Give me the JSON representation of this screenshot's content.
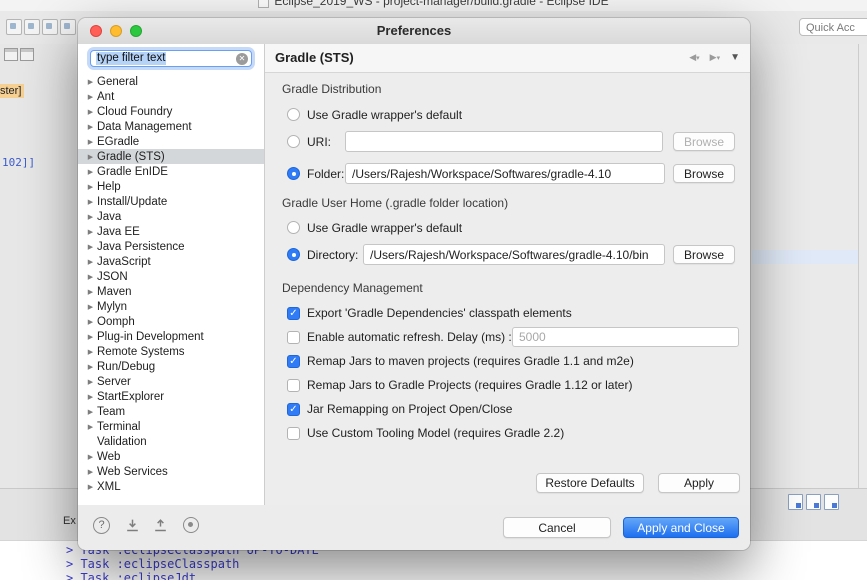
{
  "menubar": {
    "window_title": "Eclipse_2019_WS - project-manager/build.gradle - Eclipse IDE"
  },
  "toolbar": {
    "quick_access_label": "Quick Acc"
  },
  "workbench": {
    "left_fragment_tab": "ster]",
    "left_fragment_number": "102]]",
    "left_fragment_ex": "Ex",
    "console_lines": [
      "> Task :eclipseClasspath UP-TO-DATE",
      "> Task :eclipseClasspath",
      "> Task :eclipseJdt"
    ]
  },
  "dialog": {
    "title": "Preferences",
    "filter_text": "type filter text",
    "tree_items": [
      {
        "label": "General",
        "expandable": true,
        "selected": false
      },
      {
        "label": "Ant",
        "expandable": true,
        "selected": false
      },
      {
        "label": "Cloud Foundry",
        "expandable": true,
        "selected": false
      },
      {
        "label": "Data Management",
        "expandable": true,
        "selected": false
      },
      {
        "label": "EGradle",
        "expandable": true,
        "selected": false
      },
      {
        "label": "Gradle (STS)",
        "expandable": true,
        "selected": true
      },
      {
        "label": "Gradle EnIDE",
        "expandable": true,
        "selected": false
      },
      {
        "label": "Help",
        "expandable": true,
        "selected": false
      },
      {
        "label": "Install/Update",
        "expandable": true,
        "selected": false
      },
      {
        "label": "Java",
        "expandable": true,
        "selected": false
      },
      {
        "label": "Java EE",
        "expandable": true,
        "selected": false
      },
      {
        "label": "Java Persistence",
        "expandable": true,
        "selected": false
      },
      {
        "label": "JavaScript",
        "expandable": true,
        "selected": false
      },
      {
        "label": "JSON",
        "expandable": true,
        "selected": false
      },
      {
        "label": "Maven",
        "expandable": true,
        "selected": false
      },
      {
        "label": "Mylyn",
        "expandable": true,
        "selected": false
      },
      {
        "label": "Oomph",
        "expandable": true,
        "selected": false
      },
      {
        "label": "Plug-in Development",
        "expandable": true,
        "selected": false
      },
      {
        "label": "Remote Systems",
        "expandable": true,
        "selected": false
      },
      {
        "label": "Run/Debug",
        "expandable": true,
        "selected": false
      },
      {
        "label": "Server",
        "expandable": true,
        "selected": false
      },
      {
        "label": "StartExplorer",
        "expandable": true,
        "selected": false
      },
      {
        "label": "Team",
        "expandable": true,
        "selected": false
      },
      {
        "label": "Terminal",
        "expandable": true,
        "selected": false
      },
      {
        "label": "Validation",
        "expandable": false,
        "selected": false
      },
      {
        "label": "Web",
        "expandable": true,
        "selected": false
      },
      {
        "label": "Web Services",
        "expandable": true,
        "selected": false
      },
      {
        "label": "XML",
        "expandable": true,
        "selected": false
      }
    ],
    "panel": {
      "title": "Gradle (STS)",
      "distribution": {
        "heading": "Gradle Distribution",
        "wrapper_option": "Use Gradle wrapper's default",
        "uri_label": "URI:",
        "uri_value": "",
        "folder_label": "Folder:",
        "folder_value": "/Users/Rajesh/Workspace/Softwares/gradle-4.10",
        "browse_label": "Browse"
      },
      "user_home": {
        "heading": "Gradle User Home (.gradle folder location)",
        "wrapper_option": "Use Gradle wrapper's default",
        "directory_label": "Directory:",
        "directory_value": "/Users/Rajesh/Workspace/Softwares/gradle-4.10/bin",
        "browse_label": "Browse"
      },
      "dependency": {
        "heading": "Dependency Management",
        "options": [
          {
            "label": "Export 'Gradle Dependencies' classpath elements",
            "checked": true
          },
          {
            "label": "Enable automatic refresh. Delay (ms) :",
            "checked": false,
            "field_value": "5000"
          },
          {
            "label": "Remap Jars to maven projects (requires Gradle 1.1 and m2e)",
            "checked": true
          },
          {
            "label": "Remap Jars to Gradle Projects (requires Gradle 1.12 or later)",
            "checked": false
          },
          {
            "label": "Jar Remapping on Project Open/Close",
            "checked": true
          },
          {
            "label": "Use Custom Tooling Model (requires Gradle 2.2)",
            "checked": false
          }
        ]
      },
      "restore_defaults_label": "Restore Defaults",
      "apply_label": "Apply"
    },
    "footer": {
      "cancel_label": "Cancel",
      "apply_close_label": "Apply and Close"
    },
    "colors": {
      "accent_blue": "#2f7cf6",
      "primary_button_blue": "#1e6ff0",
      "selection_gray": "#d3d7da",
      "tab_highlight_orange": "#f6d092",
      "console_text_blue": "#3d3dd2"
    }
  }
}
